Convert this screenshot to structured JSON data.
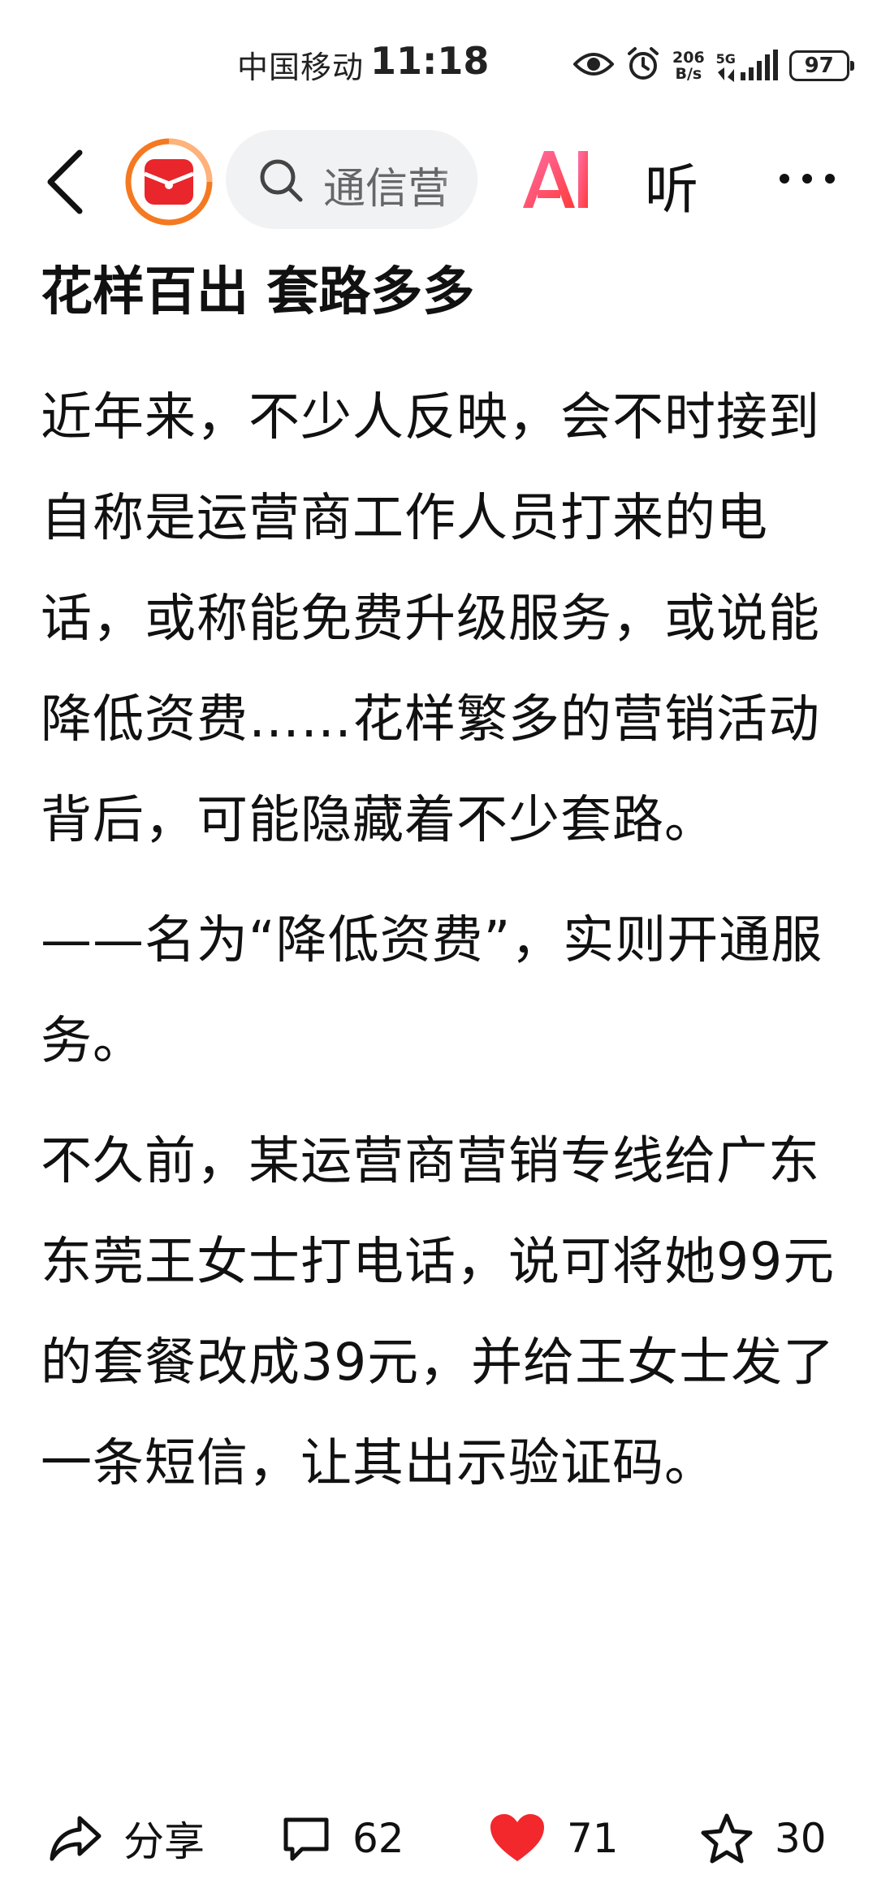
{
  "status_bar": {
    "carrier": "中国移动",
    "time": "11:18",
    "net_speed_value": "206",
    "net_speed_unit": "B/s",
    "network_type": "5G",
    "battery": "97"
  },
  "top_nav": {
    "search_placeholder": "通信营",
    "ai_label": "AI",
    "listen_label": "听"
  },
  "article": {
    "heading": "花样百出 套路多多",
    "paragraphs": [
      "近年来，不少人反映，会不时接到自称是运营商工作人员打来的电话，或称能免费升级服务，或说能降低资费……花样繁多的营销活动背后，可能隐藏着不少套路。",
      "——名为“降低资费”，实则开通服务。",
      "不久前，某运营商营销专线给广东东莞王女士打电话，说可将她99元的套餐改成39元，并给王女士发了一条短信，让其出示验证码。"
    ]
  },
  "actions": {
    "share_label": "分享",
    "comment_count": "62",
    "like_count": "71",
    "favorite_count": "30"
  },
  "colors": {
    "like_red": "#f2282d",
    "logo_orange": "#f47920",
    "logo_red": "#e8262b",
    "ai_gradient_start": "#ff6fa8",
    "ai_gradient_end": "#ff3b3b"
  },
  "icons": {
    "back": "back-arrow-icon",
    "logo": "app-logo-icon",
    "search": "search-icon",
    "more": "more-dots-icon",
    "eye": "eye-icon",
    "alarm": "alarm-icon",
    "share": "share-icon",
    "comment": "comment-icon",
    "like": "heart-icon",
    "favorite": "star-icon"
  }
}
